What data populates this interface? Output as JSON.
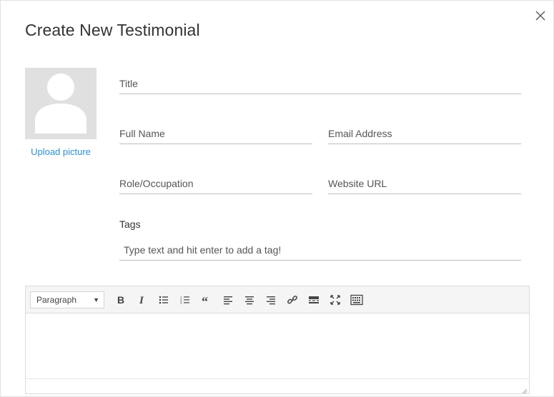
{
  "dialog": {
    "title": "Create New Testimonial",
    "close_icon": "close-icon"
  },
  "avatar": {
    "icon": "user-silhouette-icon",
    "upload_label": "Upload picture"
  },
  "form": {
    "title_placeholder": "Title",
    "full_name_placeholder": "Full Name",
    "email_placeholder": "Email Address",
    "role_placeholder": "Role/Occupation",
    "website_placeholder": "Website URL",
    "tags_label": "Tags",
    "tags_placeholder": "Type text and hit enter to add a tag!"
  },
  "editor": {
    "format_value": "Paragraph",
    "toolbar_icons": [
      "bold-icon",
      "italic-icon",
      "bullet-list-icon",
      "numbered-list-icon",
      "blockquote-icon",
      "align-left-icon",
      "align-center-icon",
      "align-right-icon",
      "link-icon",
      "read-more-icon",
      "fullscreen-icon",
      "toolbar-toggle-icon"
    ],
    "content": ""
  },
  "colors": {
    "link": "#2e8fd1",
    "avatar_bg": "#e0e0e0",
    "toolbar_bg": "#f5f5f5"
  }
}
